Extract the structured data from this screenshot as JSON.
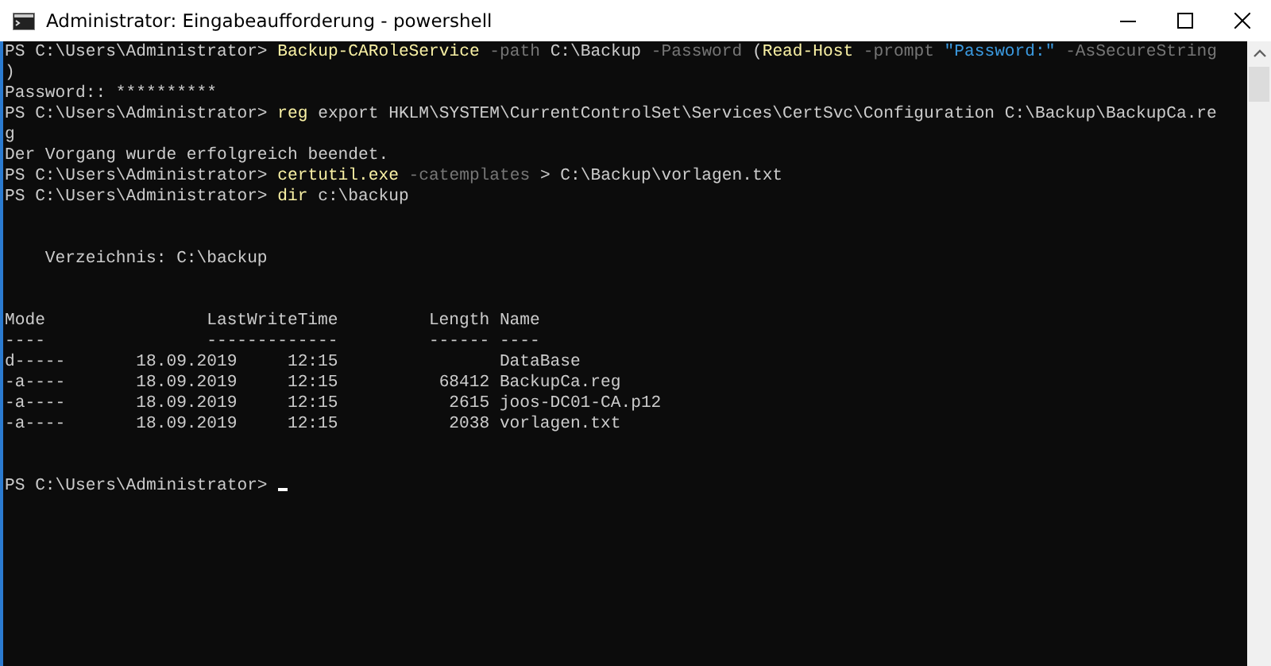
{
  "window": {
    "title": "Administrator: Eingabeaufforderung - powershell"
  },
  "lines": [
    {
      "kind": "text",
      "segments": [
        {
          "kind": "prompt",
          "text": "PS C:\\Users\\Administrator> "
        },
        {
          "kind": "command",
          "text": "Backup-CARoleService"
        },
        {
          "kind": "param",
          "text": " -path "
        },
        {
          "kind": "plain",
          "text": "C:\\Backup "
        },
        {
          "kind": "param",
          "text": "-Password "
        },
        {
          "kind": "plain",
          "text": "("
        },
        {
          "kind": "command",
          "text": "Read-Host"
        },
        {
          "kind": "param",
          "text": " -prompt "
        },
        {
          "kind": "string",
          "text": "\"Password:\""
        },
        {
          "kind": "param",
          "text": " -AsSecureString"
        }
      ]
    },
    {
      "kind": "text",
      "segments": [
        {
          "kind": "plain",
          "text": ")"
        }
      ]
    },
    {
      "kind": "text",
      "segments": [
        {
          "kind": "plain",
          "text": "Password:: **********"
        }
      ]
    },
    {
      "kind": "text",
      "segments": [
        {
          "kind": "prompt",
          "text": "PS C:\\Users\\Administrator> "
        },
        {
          "kind": "command",
          "text": "reg"
        },
        {
          "kind": "plain",
          "text": " export HKLM\\SYSTEM\\CurrentControlSet\\Services\\CertSvc\\Configuration C:\\Backup\\BackupCa.re"
        }
      ]
    },
    {
      "kind": "text",
      "segments": [
        {
          "kind": "plain",
          "text": "g"
        }
      ]
    },
    {
      "kind": "text",
      "segments": [
        {
          "kind": "plain",
          "text": "Der Vorgang wurde erfolgreich beendet."
        }
      ]
    },
    {
      "kind": "text",
      "segments": [
        {
          "kind": "prompt",
          "text": "PS C:\\Users\\Administrator> "
        },
        {
          "kind": "command",
          "text": "certutil.exe"
        },
        {
          "kind": "param",
          "text": " -catemplates"
        },
        {
          "kind": "plain",
          "text": " > C:\\Backup\\vorlagen.txt"
        }
      ]
    },
    {
      "kind": "text",
      "segments": [
        {
          "kind": "prompt",
          "text": "PS C:\\Users\\Administrator> "
        },
        {
          "kind": "command",
          "text": "dir"
        },
        {
          "kind": "plain",
          "text": " c:\\backup"
        }
      ]
    },
    {
      "kind": "blank"
    },
    {
      "kind": "blank"
    },
    {
      "kind": "text",
      "indent": true,
      "segments": [
        {
          "kind": "plain",
          "text": "Verzeichnis: C:\\backup"
        }
      ]
    },
    {
      "kind": "blank"
    },
    {
      "kind": "blank"
    }
  ],
  "listing": {
    "columns": [
      {
        "header": "Mode",
        "rule": "----"
      },
      {
        "header": "LastWriteTime",
        "rule": "-------------"
      },
      {
        "header": "Length",
        "rule": "------"
      },
      {
        "header": "Name",
        "rule": "----"
      }
    ],
    "rows": [
      {
        "mode": "d-----",
        "date": "18.09.2019",
        "time": "12:15",
        "name": "DataBase"
      },
      {
        "mode": "-a----",
        "date": "18.09.2019",
        "time": "12:15",
        "length": "68412",
        "name": "BackupCa.reg"
      },
      {
        "mode": "-a----",
        "date": "18.09.2019",
        "time": "12:15",
        "length": "2615",
        "name": "joos-DC01-CA.p12"
      },
      {
        "mode": "-a----",
        "date": "18.09.2019",
        "time": "12:15",
        "length": "2038",
        "name": "vorlagen.txt"
      }
    ]
  },
  "final_prompt": {
    "text": "PS C:\\Users\\Administrator> ",
    "cursor": true
  }
}
